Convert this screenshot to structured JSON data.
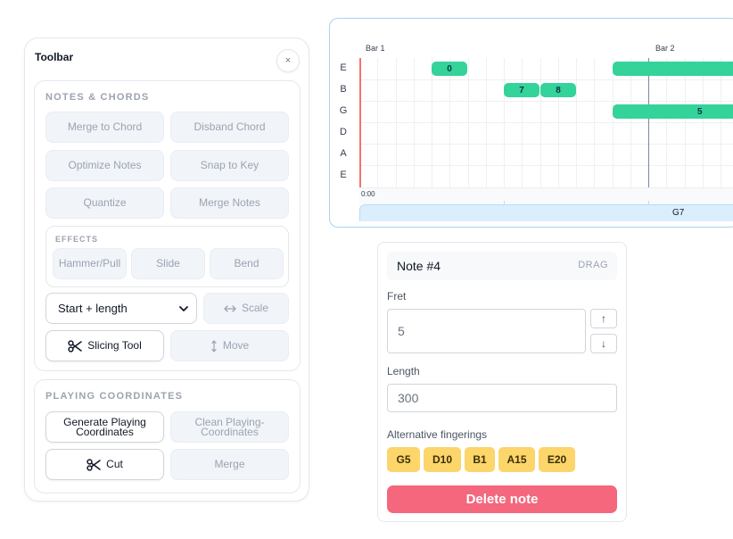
{
  "toolbar": {
    "title": "Toolbar",
    "close_glyph": "×",
    "notes_section": {
      "title": "NOTES & CHORDS",
      "merge_to_chord": "Merge to Chord",
      "disband_chord": "Disband Chord",
      "optimize_notes": "Optimize Notes",
      "snap_to_key": "Snap to Key",
      "quantize": "Quantize",
      "merge_notes": "Merge Notes",
      "effects": {
        "title": "EFFECTS",
        "hammer_pull": "Hammer/Pull",
        "slide": "Slide",
        "bend": "Bend"
      },
      "selection_mode": "Start + length",
      "scale": "Scale",
      "slicing_tool": "Slicing Tool",
      "move": "Move"
    },
    "playing_section": {
      "title": "PLAYING COORDINATES",
      "generate_line1": "Generate Playing",
      "generate_line2": "Coordinates",
      "clean_line1": "Clean Playing-",
      "clean_line2": "Coordinates",
      "cut": "Cut",
      "merge": "Merge"
    }
  },
  "timeline": {
    "bars": [
      "Bar 1",
      "Bar 2"
    ],
    "strings": [
      "E",
      "B",
      "G",
      "D",
      "A",
      "E"
    ],
    "notes": [
      {
        "string": 0,
        "label": "0"
      },
      {
        "string": 0,
        "label": ""
      },
      {
        "string": 1,
        "label": "7"
      },
      {
        "string": 1,
        "label": "8"
      },
      {
        "string": 2,
        "label": "5"
      }
    ],
    "time_start": "0:00",
    "chord": "G7",
    "colors": {
      "note": "#34d399",
      "playhead": "#f87171",
      "chord_strip": "#dbeefe"
    }
  },
  "note_panel": {
    "title": "Note #4",
    "drag": "DRAG",
    "fret_label": "Fret",
    "fret_value": "5",
    "step_up": "↑",
    "step_down": "↓",
    "length_label": "Length",
    "length_value": "300",
    "alt_label": "Alternative fingerings",
    "alternatives": [
      "G5",
      "D10",
      "B1",
      "A15",
      "E20"
    ],
    "delete": "Delete note",
    "colors": {
      "chip": "#fcd56b",
      "delete": "#f4677d"
    }
  }
}
